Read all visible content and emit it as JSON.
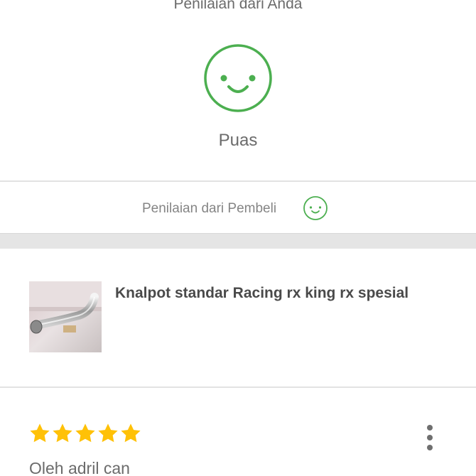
{
  "seller_rating": {
    "title": "Penilaian dari Anda",
    "value": "Puas",
    "icon": "smiley-happy-icon",
    "color": "#4caf50"
  },
  "buyer_rating": {
    "label": "Penilaian dari Pembeli",
    "icon": "smiley-happy-icon"
  },
  "product": {
    "name": "Knalpot standar Racing rx king rx spesial",
    "thumbnail": "exhaust-pipe-photo"
  },
  "review": {
    "stars": 5,
    "star_color": "#ffc107",
    "reviewer_text": "Oleh adril can",
    "menu_icon": "more-vertical-icon"
  }
}
